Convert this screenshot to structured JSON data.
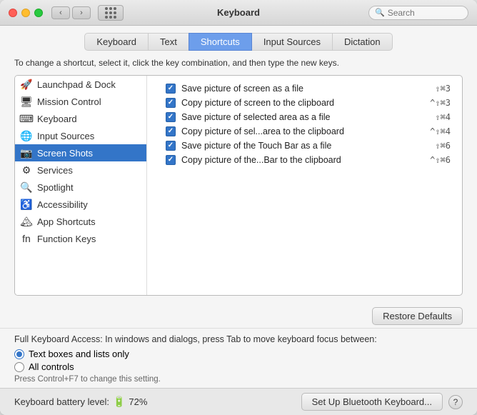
{
  "window": {
    "title": "Keyboard",
    "search_placeholder": "Search"
  },
  "tabs": [
    {
      "id": "keyboard",
      "label": "Keyboard",
      "active": false
    },
    {
      "id": "text",
      "label": "Text",
      "active": false
    },
    {
      "id": "shortcuts",
      "label": "Shortcuts",
      "active": true
    },
    {
      "id": "input-sources",
      "label": "Input Sources",
      "active": false
    },
    {
      "id": "dictation",
      "label": "Dictation",
      "active": false
    }
  ],
  "hint": "To change a shortcut, select it, click the key combination, and then type the new keys.",
  "sidebar": {
    "items": [
      {
        "id": "launchpad",
        "label": "Launchpad & Dock",
        "icon": "🚀",
        "selected": false
      },
      {
        "id": "mission-control",
        "label": "Mission Control",
        "icon": "🖥",
        "selected": false
      },
      {
        "id": "keyboard",
        "label": "Keyboard",
        "icon": "⌨",
        "selected": false
      },
      {
        "id": "input-sources",
        "label": "Input Sources",
        "icon": "🌐",
        "selected": false
      },
      {
        "id": "screen-shots",
        "label": "Screen Shots",
        "icon": "📷",
        "selected": true
      },
      {
        "id": "services",
        "label": "Services",
        "icon": "⚙",
        "selected": false
      },
      {
        "id": "spotlight",
        "label": "Spotlight",
        "icon": "🔍",
        "selected": false
      },
      {
        "id": "accessibility",
        "label": "Accessibility",
        "icon": "♿",
        "selected": false
      },
      {
        "id": "app-shortcuts",
        "label": "App Shortcuts",
        "icon": "🏔",
        "selected": false
      },
      {
        "id": "function-keys",
        "label": "Function Keys",
        "icon": "fn",
        "selected": false
      }
    ]
  },
  "shortcuts": [
    {
      "id": "sc1",
      "checked": true,
      "label": "Save picture of screen as a file",
      "key": "⇧⌘3"
    },
    {
      "id": "sc2",
      "checked": true,
      "label": "Copy picture of screen to the clipboard",
      "key": "^⇧⌘3"
    },
    {
      "id": "sc3",
      "checked": true,
      "label": "Save picture of selected area as a file",
      "key": "⇧⌘4"
    },
    {
      "id": "sc4",
      "checked": true,
      "label": "Copy picture of sel...area to the clipboard",
      "key": "^⇧⌘4"
    },
    {
      "id": "sc5",
      "checked": true,
      "label": "Save picture of the Touch Bar as a file",
      "key": "⇧⌘6"
    },
    {
      "id": "sc6",
      "checked": true,
      "label": "Copy picture of the...Bar to the clipboard",
      "key": "^⇧⌘6"
    }
  ],
  "restore_button": "Restore Defaults",
  "keyboard_access": {
    "title": "Full Keyboard Access: In windows and dialogs, press Tab to move keyboard focus between:",
    "options": [
      {
        "id": "text-boxes",
        "label": "Text boxes and lists only",
        "selected": true
      },
      {
        "id": "all-controls",
        "label": "All controls",
        "selected": false
      }
    ],
    "note": "Press Control+F7 to change this setting."
  },
  "status_bar": {
    "battery_label": "Keyboard battery level:",
    "battery_percent": "72%",
    "setup_button": "Set Up Bluetooth Keyboard...",
    "help_button": "?"
  }
}
